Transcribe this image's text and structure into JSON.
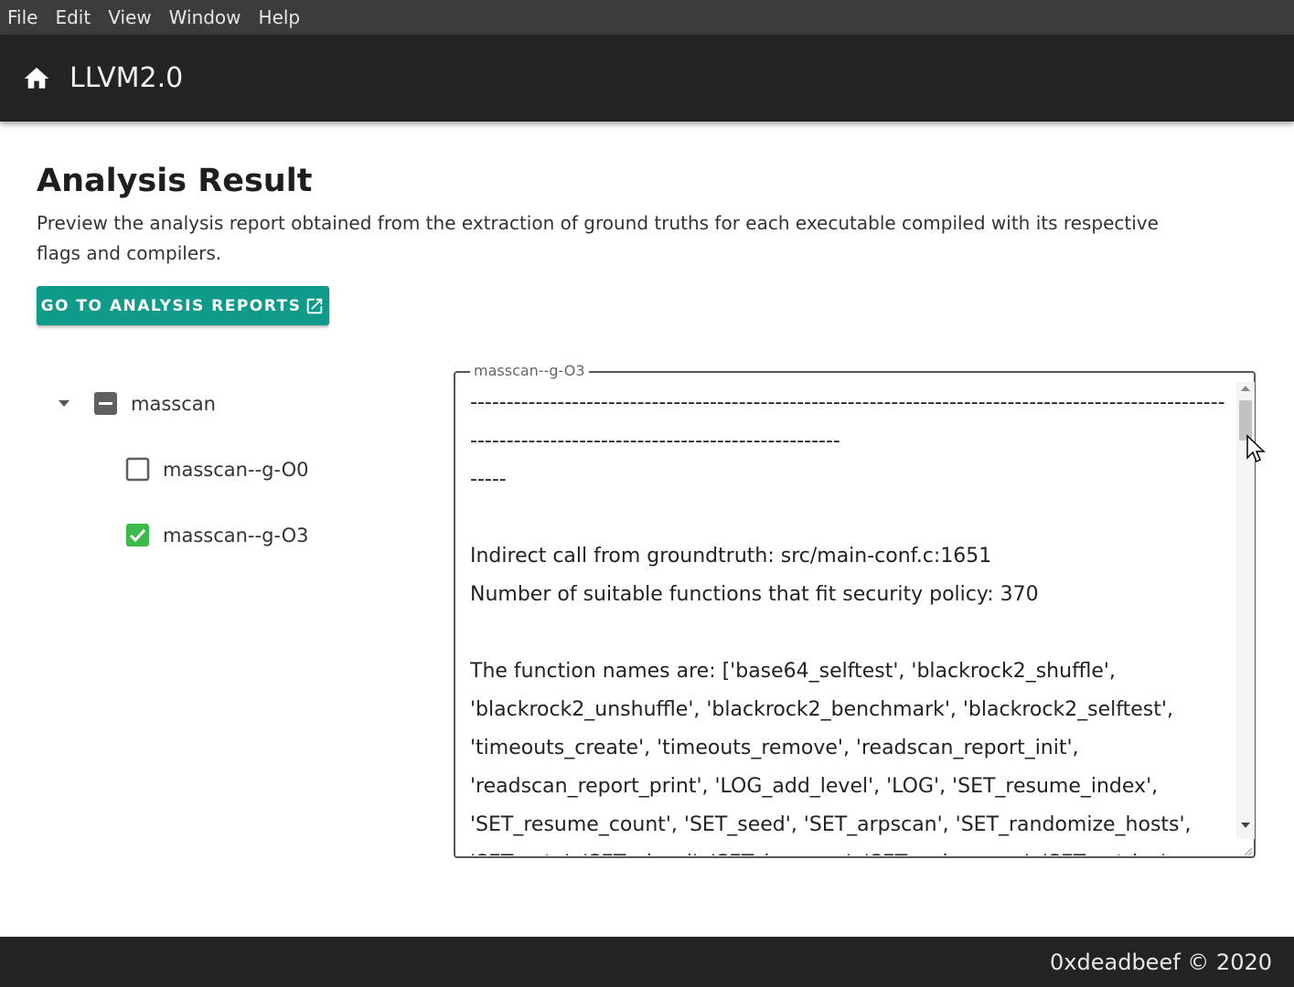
{
  "menu": [
    "File",
    "Edit",
    "View",
    "Window",
    "Help"
  ],
  "app": {
    "title": "LLVM2.0",
    "home_icon": "home-icon"
  },
  "page": {
    "title": "Analysis Result",
    "description": "Preview the analysis report obtained from the extraction of ground truths for each executable compiled with its respective flags and compilers."
  },
  "reports_button": {
    "label": "GO TO ANALYSIS REPORTS",
    "icon": "external-link-icon",
    "color": "#0f9a8a"
  },
  "tree": {
    "root": {
      "label": "masscan",
      "state": "indeterminate"
    },
    "children": [
      {
        "label": "masscan--g-O0",
        "checked": false
      },
      {
        "label": "masscan--g-O3",
        "checked": true
      }
    ],
    "check_color": "#3dbb4a"
  },
  "report": {
    "legend": "masscan--g-O3",
    "text": "-----------------------------------------------------------------------------------------------------------------------------------------------------------\n-----\n\nIndirect call from groundtruth: src/main-conf.c:1651\nNumber of suitable functions that fit security policy: 370\n\nThe function names are: ['base64_selftest', 'blackrock2_shuffle', 'blackrock2_unshuffle', 'blackrock2_benchmark', 'blackrock2_selftest', 'timeouts_create', 'timeouts_remove', 'readscan_report_init', 'readscan_report_print', 'LOG_add_level', 'LOG', 'SET_resume_index', 'SET_resume_count', 'SET_seed', 'SET_arpscan', 'SET_randomize_hosts', 'SET_rate', 'SET_shard', 'SET_banners', 'SET_nobanners', 'SET_retries', 'SET_noreset', 'SET_nmap_payloads', 'SET_nmap_service_probes'"
  },
  "footer": {
    "text": "0xdeadbeef © 2020"
  }
}
